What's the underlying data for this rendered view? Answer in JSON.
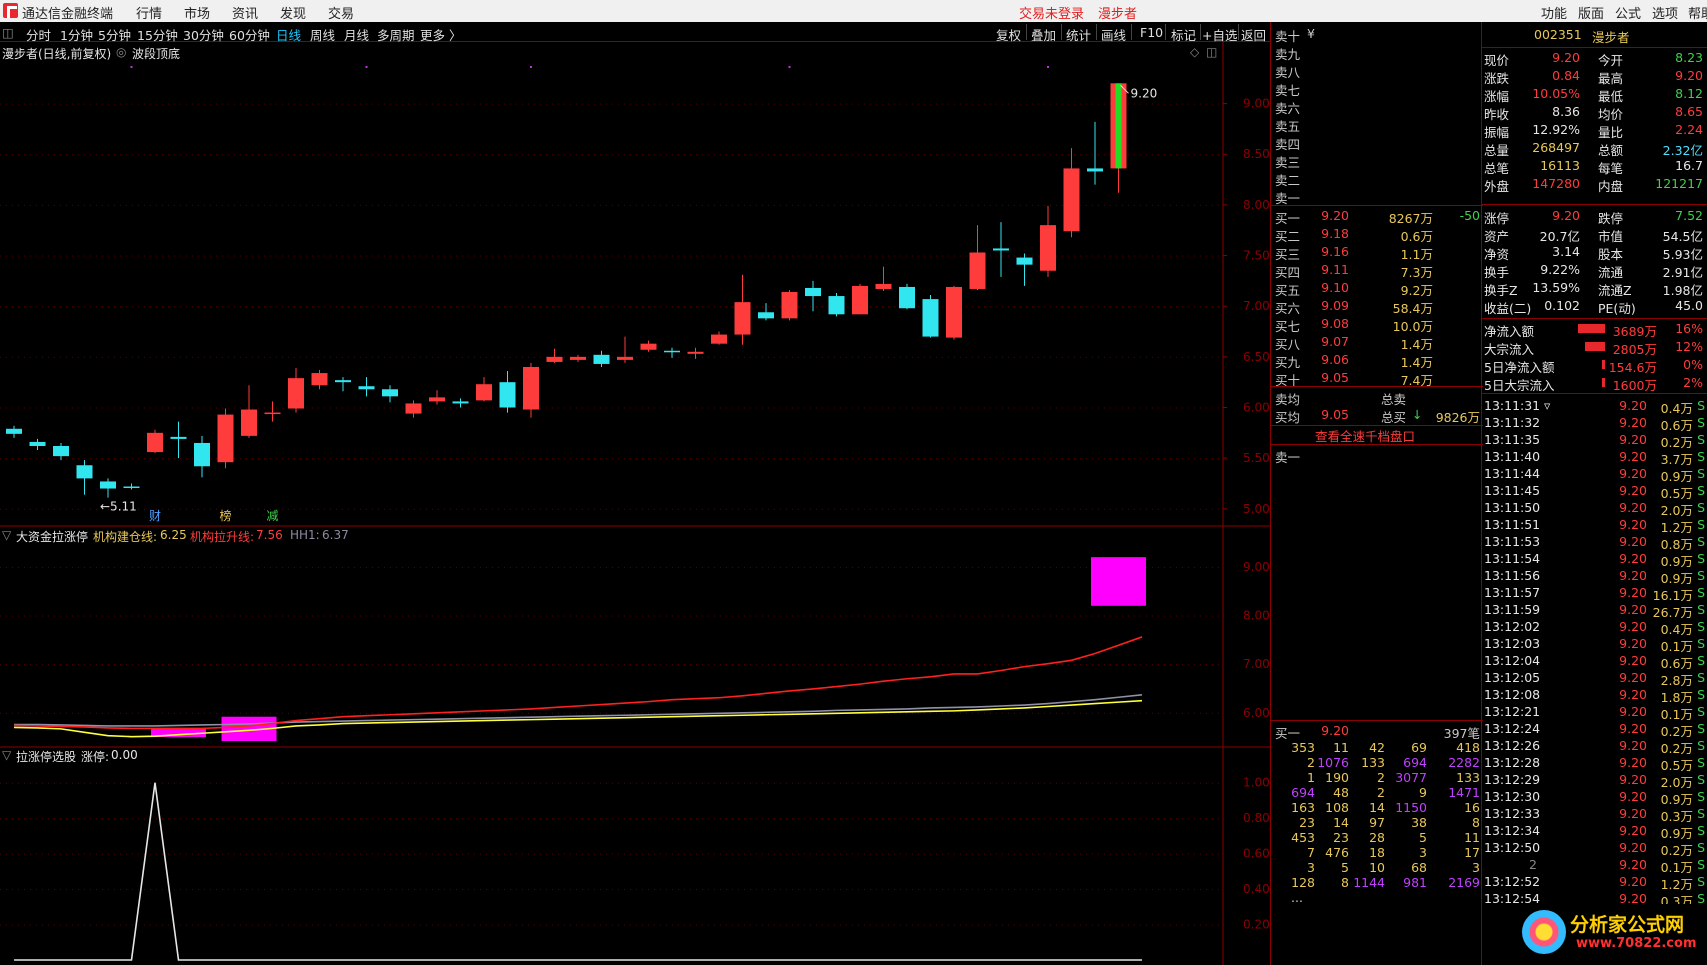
{
  "titlebar": {
    "app_title": "通达信金融终端",
    "menus": [
      "行情",
      "市场",
      "资讯",
      "发现",
      "交易"
    ],
    "login_status": "交易未登录",
    "stock_short": "漫步者",
    "right_menus": [
      "功能",
      "版面",
      "公式",
      "选项",
      "帮助"
    ]
  },
  "toolbar": {
    "periods": [
      "分时",
      "1分钟",
      "5分钟",
      "15分钟",
      "30分钟",
      "60分钟",
      "日线",
      "周线",
      "月线",
      "多周期",
      "更多 〉"
    ],
    "selected": "日线",
    "right_tools": [
      "复权",
      "叠加",
      "统计",
      "画线",
      "F10",
      "标记",
      "+自选",
      "返回"
    ]
  },
  "main_pane": {
    "title": "漫步者(日线,前复权)",
    "indicator": "波段顶底",
    "y_ticks": [
      "9.00",
      "8.50",
      "8.00",
      "7.50",
      "7.00",
      "6.50",
      "6.00",
      "5.50",
      "5.00"
    ],
    "high_label": "9.20",
    "low_label": "←5.11",
    "markers": [
      "财",
      "榜",
      "减"
    ]
  },
  "indicator_pane1": {
    "title": "大资金拉涨停",
    "line1_label": "机构建仓线:",
    "line1_value": "6.25",
    "line2_label": "机构拉升线:",
    "line2_value": "7.56",
    "line3_label": "HH1:",
    "line3_value": "6.37",
    "y_ticks": [
      "9.00",
      "8.00",
      "7.00",
      "6.00"
    ]
  },
  "indicator_pane2": {
    "title": "拉涨停选股",
    "value_label": "涨停:",
    "value": "0.00",
    "y_ticks": [
      "1.00",
      "0.80",
      "0.60",
      "0.40",
      "0.20"
    ]
  },
  "chart_data": {
    "type": "candlestick",
    "ylim": [
      4.85,
      9.45
    ],
    "candles": [
      {
        "o": 5.79,
        "c": 5.74,
        "h": 5.82,
        "l": 5.7
      },
      {
        "o": 5.66,
        "c": 5.62,
        "h": 5.69,
        "l": 5.58
      },
      {
        "o": 5.62,
        "c": 5.52,
        "h": 5.65,
        "l": 5.48
      },
      {
        "o": 5.43,
        "c": 5.3,
        "h": 5.48,
        "l": 5.14
      },
      {
        "o": 5.27,
        "c": 5.2,
        "h": 5.3,
        "l": 5.11
      },
      {
        "o": 5.22,
        "c": 5.21,
        "h": 5.25,
        "l": 5.19
      },
      {
        "o": 5.56,
        "c": 5.75,
        "h": 5.78,
        "l": 5.55
      },
      {
        "o": 5.71,
        "c": 5.69,
        "h": 5.86,
        "l": 5.5
      },
      {
        "o": 5.65,
        "c": 5.42,
        "h": 5.72,
        "l": 5.31
      },
      {
        "o": 5.46,
        "c": 5.93,
        "h": 5.99,
        "l": 5.4
      },
      {
        "o": 5.72,
        "c": 5.98,
        "h": 6.22,
        "l": 5.7
      },
      {
        "o": 5.94,
        "c": 5.95,
        "h": 6.06,
        "l": 5.86
      },
      {
        "o": 5.99,
        "c": 6.29,
        "h": 6.39,
        "l": 5.95
      },
      {
        "o": 6.22,
        "c": 6.34,
        "h": 6.37,
        "l": 6.18
      },
      {
        "o": 6.27,
        "c": 6.25,
        "h": 6.3,
        "l": 6.16
      },
      {
        "o": 6.21,
        "c": 6.18,
        "h": 6.3,
        "l": 6.11
      },
      {
        "o": 6.18,
        "c": 6.11,
        "h": 6.22,
        "l": 6.05
      },
      {
        "o": 5.94,
        "c": 6.04,
        "h": 6.07,
        "l": 5.9
      },
      {
        "o": 6.06,
        "c": 6.1,
        "h": 6.17,
        "l": 6.03
      },
      {
        "o": 6.06,
        "c": 6.04,
        "h": 6.09,
        "l": 6.0
      },
      {
        "o": 6.07,
        "c": 6.23,
        "h": 6.3,
        "l": 6.06
      },
      {
        "o": 6.25,
        "c": 6.0,
        "h": 6.36,
        "l": 5.95
      },
      {
        "o": 5.98,
        "c": 6.4,
        "h": 6.44,
        "l": 5.9
      },
      {
        "o": 6.45,
        "c": 6.5,
        "h": 6.58,
        "l": 6.44
      },
      {
        "o": 6.47,
        "c": 6.5,
        "h": 6.52,
        "l": 6.45
      },
      {
        "o": 6.52,
        "c": 6.43,
        "h": 6.56,
        "l": 6.4
      },
      {
        "o": 6.47,
        "c": 6.5,
        "h": 6.7,
        "l": 6.44
      },
      {
        "o": 6.57,
        "c": 6.63,
        "h": 6.66,
        "l": 6.55
      },
      {
        "o": 6.56,
        "c": 6.55,
        "h": 6.59,
        "l": 6.49
      },
      {
        "o": 6.53,
        "c": 6.55,
        "h": 6.59,
        "l": 6.48
      },
      {
        "o": 6.63,
        "c": 6.72,
        "h": 6.75,
        "l": 6.62
      },
      {
        "o": 6.72,
        "c": 7.04,
        "h": 7.31,
        "l": 6.62
      },
      {
        "o": 6.94,
        "c": 6.88,
        "h": 7.03,
        "l": 6.86
      },
      {
        "o": 6.88,
        "c": 7.14,
        "h": 7.16,
        "l": 6.86
      },
      {
        "o": 7.18,
        "c": 7.1,
        "h": 7.25,
        "l": 6.95
      },
      {
        "o": 7.1,
        "c": 6.92,
        "h": 7.13,
        "l": 6.9
      },
      {
        "o": 6.92,
        "c": 7.2,
        "h": 7.22,
        "l": 6.92
      },
      {
        "o": 7.17,
        "c": 7.22,
        "h": 7.39,
        "l": 7.15
      },
      {
        "o": 7.19,
        "c": 6.98,
        "h": 7.22,
        "l": 6.97
      },
      {
        "o": 7.07,
        "c": 6.7,
        "h": 7.11,
        "l": 6.69
      },
      {
        "o": 6.69,
        "c": 7.19,
        "h": 7.2,
        "l": 6.67
      },
      {
        "o": 7.17,
        "c": 7.53,
        "h": 7.8,
        "l": 7.16
      },
      {
        "o": 7.57,
        "c": 7.55,
        "h": 7.83,
        "l": 7.29
      },
      {
        "o": 7.48,
        "c": 7.41,
        "h": 7.52,
        "l": 7.2
      },
      {
        "o": 7.35,
        "c": 7.8,
        "h": 7.99,
        "l": 7.29
      },
      {
        "o": 7.74,
        "c": 8.36,
        "h": 8.56,
        "l": 7.68
      },
      {
        "o": 8.36,
        "c": 8.33,
        "h": 8.82,
        "l": 8.2
      },
      {
        "o": 8.36,
        "c": 9.2,
        "h": 9.2,
        "l": 8.12
      }
    ],
    "ind1_red": [
      5.74,
      5.73,
      5.72,
      5.71,
      5.69,
      5.68,
      5.68,
      5.68,
      5.68,
      5.7,
      5.73,
      5.78,
      5.84,
      5.88,
      5.92,
      5.94,
      5.96,
      5.98,
      6.0,
      6.02,
      6.04,
      6.06,
      6.08,
      6.11,
      6.14,
      6.17,
      6.2,
      6.23,
      6.27,
      6.29,
      6.31,
      6.35,
      6.4,
      6.45,
      6.49,
      6.54,
      6.59,
      6.65,
      6.7,
      6.74,
      6.8,
      6.8,
      6.87,
      6.95,
      7.01,
      7.08,
      7.22,
      7.39,
      7.56
    ],
    "ind1_yellow": [
      5.7,
      5.69,
      5.67,
      5.6,
      5.53,
      5.51,
      5.52,
      5.55,
      5.58,
      5.61,
      5.64,
      5.68,
      5.73,
      5.75,
      5.78,
      5.79,
      5.8,
      5.81,
      5.82,
      5.83,
      5.84,
      5.85,
      5.86,
      5.87,
      5.88,
      5.89,
      5.9,
      5.91,
      5.92,
      5.93,
      5.94,
      5.95,
      5.96,
      5.97,
      5.98,
      5.99,
      6.0,
      6.01,
      6.02,
      6.03,
      6.04,
      6.06,
      6.08,
      6.1,
      6.13,
      6.16,
      6.19,
      6.22,
      6.25
    ],
    "ind1_gray": [
      5.76,
      5.76,
      5.75,
      5.74,
      5.73,
      5.73,
      5.73,
      5.74,
      5.75,
      5.76,
      5.77,
      5.79,
      5.81,
      5.82,
      5.83,
      5.84,
      5.85,
      5.86,
      5.87,
      5.88,
      5.89,
      5.9,
      5.91,
      5.92,
      5.93,
      5.94,
      5.95,
      5.96,
      5.97,
      5.98,
      5.99,
      6.0,
      6.01,
      6.02,
      6.03,
      6.05,
      6.06,
      6.07,
      6.08,
      6.1,
      6.11,
      6.12,
      6.14,
      6.16,
      6.19,
      6.23,
      6.27,
      6.32,
      6.37
    ],
    "ind1_ylim": [
      5.4,
      9.45
    ],
    "ind1_boxes": [
      {
        "i0": 6,
        "i1": 8,
        "top": 5.68,
        "bot": 5.5
      },
      {
        "i0": 9,
        "i1": 11,
        "top": 5.92,
        "bot": 5.42
      },
      {
        "i0": 46,
        "i1": 48,
        "top": 9.2,
        "bot": 8.2
      }
    ],
    "ind2_series": [
      0,
      0,
      0,
      0,
      0,
      0,
      1,
      0,
      0,
      0,
      0,
      0,
      0,
      0,
      0,
      0,
      0,
      0,
      0,
      0,
      0,
      0,
      0,
      0,
      0,
      0,
      0,
      0,
      0,
      0,
      0,
      0,
      0,
      0,
      0,
      0,
      0,
      0,
      0,
      0,
      0,
      0,
      0,
      0,
      0,
      0,
      0,
      0,
      0
    ],
    "ind2_ylim": [
      0,
      1.1
    ]
  },
  "quote": {
    "sell": [
      {
        "label": "卖十",
        "price": "",
        "vol": ""
      },
      {
        "label": "卖九",
        "price": "",
        "vol": ""
      },
      {
        "label": "卖八",
        "price": "",
        "vol": ""
      },
      {
        "label": "卖七",
        "price": "",
        "vol": ""
      },
      {
        "label": "卖六",
        "price": "",
        "vol": ""
      },
      {
        "label": "卖五",
        "price": "",
        "vol": ""
      },
      {
        "label": "卖四",
        "price": "",
        "vol": ""
      },
      {
        "label": "卖三",
        "price": "",
        "vol": ""
      },
      {
        "label": "卖二",
        "price": "",
        "vol": ""
      },
      {
        "label": "卖一",
        "price": "",
        "vol": ""
      }
    ],
    "sell_head_extra": "¥",
    "buy": [
      {
        "label": "买一",
        "price": "9.20",
        "vol": "8267万",
        "chg": "-50"
      },
      {
        "label": "买二",
        "price": "9.18",
        "vol": "0.6万",
        "chg": ""
      },
      {
        "label": "买三",
        "price": "9.16",
        "vol": "1.1万",
        "chg": ""
      },
      {
        "label": "买四",
        "price": "9.11",
        "vol": "7.3万",
        "chg": ""
      },
      {
        "label": "买五",
        "price": "9.10",
        "vol": "9.2万",
        "chg": ""
      },
      {
        "label": "买六",
        "price": "9.09",
        "vol": "58.4万",
        "chg": ""
      },
      {
        "label": "买七",
        "price": "9.08",
        "vol": "10.0万",
        "chg": ""
      },
      {
        "label": "买八",
        "price": "9.07",
        "vol": "1.4万",
        "chg": ""
      },
      {
        "label": "买九",
        "price": "9.06",
        "vol": "1.4万",
        "chg": ""
      },
      {
        "label": "买十",
        "price": "9.05",
        "vol": "7.4万",
        "chg": ""
      }
    ],
    "avg_sell_label": "卖均",
    "total_sell_label": "总卖",
    "avg_buy_label": "买均",
    "avg_buy": "9.05",
    "total_buy_label": "总买",
    "total_buy": "9826万",
    "fast_link": "查看全速千档盘口",
    "sell1_label": "卖一",
    "buy1_label": "买一",
    "buy1_price": "9.20",
    "buy1_count": "397笔",
    "queue": [
      [
        "353",
        "11",
        "42",
        "69",
        "418"
      ],
      [
        "2",
        "1076",
        "133",
        "694",
        "2282"
      ],
      [
        "1",
        "190",
        "2",
        "3077",
        "133"
      ],
      [
        "694",
        "48",
        "2",
        "9",
        "1471"
      ],
      [
        "163",
        "108",
        "14",
        "1150",
        "16"
      ],
      [
        "23",
        "14",
        "97",
        "38",
        "8"
      ],
      [
        "453",
        "23",
        "28",
        "5",
        "11"
      ],
      [
        "7",
        "476",
        "18",
        "3",
        "17"
      ],
      [
        "3",
        "5",
        "10",
        "68",
        "3"
      ],
      [
        "128",
        "8",
        "1144",
        "981",
        "2169"
      ]
    ],
    "queue_more": "..."
  },
  "info": {
    "code": "002351",
    "name": "漫步者",
    "pairs": [
      [
        "现价",
        "9.20",
        "今开",
        "8.23"
      ],
      [
        "涨跌",
        "0.84",
        "最高",
        "9.20"
      ],
      [
        "涨幅",
        "10.05%",
        "最低",
        "8.12"
      ],
      [
        "昨收",
        "8.36",
        "均价",
        "8.65"
      ],
      [
        "振幅",
        "12.92%",
        "量比",
        "2.24"
      ],
      [
        "总量",
        "268497",
        "总额",
        "2.32亿"
      ],
      [
        "总笔",
        "16113",
        "每笔",
        "16.7"
      ],
      [
        "外盘",
        "147280",
        "内盘",
        "121217"
      ]
    ],
    "pairs2": [
      [
        "涨停",
        "9.20",
        "跌停",
        "7.52"
      ],
      [
        "资产",
        "20.7亿",
        "市值",
        "54.5亿"
      ],
      [
        "净资",
        "3.14",
        "股本",
        "5.93亿"
      ],
      [
        "换手",
        "9.22%",
        "流通",
        "2.91亿"
      ],
      [
        "换手Z",
        "13.59%",
        "流通Z",
        "1.98亿"
      ],
      [
        "收益(二)",
        "0.102",
        "PE(动)",
        "45.0"
      ]
    ],
    "flows": [
      {
        "label": "净流入额",
        "value": "3689万",
        "pct": "16%",
        "fill": 0.16
      },
      {
        "label": "大宗流入",
        "value": "2805万",
        "pct": "12%",
        "fill": 0.12
      },
      {
        "label": "5日净流入额",
        "value": "154.6万",
        "pct": "0%",
        "fill": 0.0
      },
      {
        "label": "5日大宗流入",
        "value": "1600万",
        "pct": "2%",
        "fill": 0.02
      }
    ],
    "ticks": [
      [
        "13:11:31",
        "9.20",
        "0.4万",
        "S"
      ],
      [
        "13:11:32",
        "9.20",
        "0.6万",
        "S"
      ],
      [
        "13:11:35",
        "9.20",
        "0.2万",
        "S"
      ],
      [
        "13:11:40",
        "9.20",
        "3.7万",
        "S"
      ],
      [
        "13:11:44",
        "9.20",
        "0.9万",
        "S"
      ],
      [
        "13:11:45",
        "9.20",
        "0.5万",
        "S"
      ],
      [
        "13:11:50",
        "9.20",
        "2.0万",
        "S"
      ],
      [
        "13:11:51",
        "9.20",
        "1.2万",
        "S"
      ],
      [
        "13:11:53",
        "9.20",
        "0.8万",
        "S"
      ],
      [
        "13:11:54",
        "9.20",
        "0.9万",
        "S"
      ],
      [
        "13:11:56",
        "9.20",
        "0.9万",
        "S"
      ],
      [
        "13:11:57",
        "9.20",
        "16.1万",
        "S"
      ],
      [
        "13:11:59",
        "9.20",
        "26.7万",
        "S"
      ],
      [
        "13:12:02",
        "9.20",
        "0.4万",
        "S"
      ],
      [
        "13:12:03",
        "9.20",
        "0.1万",
        "S"
      ],
      [
        "13:12:04",
        "9.20",
        "0.6万",
        "S"
      ],
      [
        "13:12:05",
        "9.20",
        "2.8万",
        "S"
      ],
      [
        "13:12:08",
        "9.20",
        "1.8万",
        "S"
      ],
      [
        "13:12:21",
        "9.20",
        "0.1万",
        "S"
      ],
      [
        "13:12:24",
        "9.20",
        "0.2万",
        "S"
      ],
      [
        "13:12:26",
        "9.20",
        "0.2万",
        "S"
      ],
      [
        "13:12:28",
        "9.20",
        "0.5万",
        "S"
      ],
      [
        "13:12:29",
        "9.20",
        "2.0万",
        "S"
      ],
      [
        "13:12:30",
        "9.20",
        "0.9万",
        "S"
      ],
      [
        "13:12:33",
        "9.20",
        "0.3万",
        "S"
      ],
      [
        "13:12:34",
        "9.20",
        "0.9万",
        "S"
      ],
      [
        "13:12:50",
        "9.20",
        "0.2万",
        "S"
      ],
      [
        "",
        "2",
        "9.20",
        "0.1万",
        "S"
      ],
      [
        "13:12:52",
        "9.20",
        "1.2万",
        "S"
      ],
      [
        "13:12:54",
        "9.20",
        "0.3万",
        "S"
      ]
    ],
    "watermark_title": "分析家公式网",
    "watermark_url": "www.70822.com"
  },
  "colors": {
    "up": "#ff3c3c",
    "down": "#32e6f0",
    "grid": "#8b0000",
    "magenta": "#ff00ff",
    "yellow": "#ffff3c"
  }
}
